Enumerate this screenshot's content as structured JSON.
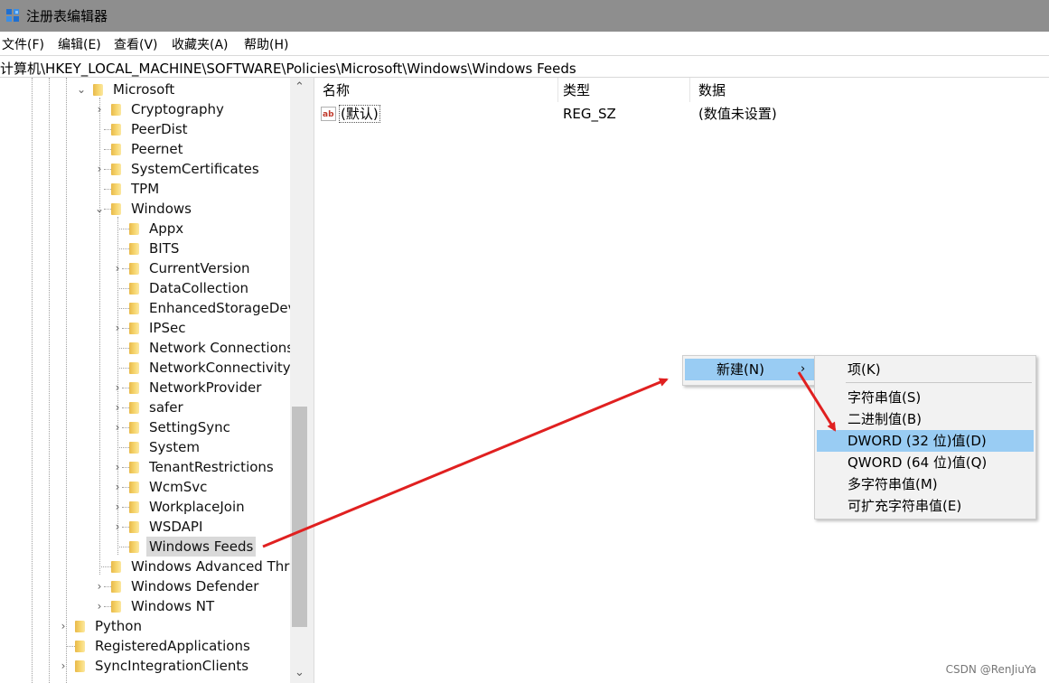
{
  "window": {
    "title": "注册表编辑器"
  },
  "menu": [
    "文件(F)",
    "编辑(E)",
    "查看(V)",
    "收藏夹(A)",
    "帮助(H)"
  ],
  "address": "计算机\\HKEY_LOCAL_MACHINE\\SOFTWARE\\Policies\\Microsoft\\Windows\\Windows Feeds",
  "tree": [
    {
      "label": "Microsoft",
      "expander": "open"
    },
    {
      "label": "Cryptography",
      "expander": "closed"
    },
    {
      "label": "PeerDist",
      "expander": "none"
    },
    {
      "label": "Peernet",
      "expander": "none"
    },
    {
      "label": "SystemCertificates",
      "expander": "closed"
    },
    {
      "label": "TPM",
      "expander": "none"
    },
    {
      "label": "Windows",
      "expander": "open"
    },
    {
      "label": "Appx",
      "expander": "none"
    },
    {
      "label": "BITS",
      "expander": "none"
    },
    {
      "label": "CurrentVersion",
      "expander": "closed"
    },
    {
      "label": "DataCollection",
      "expander": "none"
    },
    {
      "label": "EnhancedStorageDev",
      "expander": "none"
    },
    {
      "label": "IPSec",
      "expander": "closed"
    },
    {
      "label": "Network Connections",
      "expander": "none"
    },
    {
      "label": "NetworkConnectivity:",
      "expander": "none"
    },
    {
      "label": "NetworkProvider",
      "expander": "closed"
    },
    {
      "label": "safer",
      "expander": "closed"
    },
    {
      "label": "SettingSync",
      "expander": "closed"
    },
    {
      "label": "System",
      "expander": "none"
    },
    {
      "label": "TenantRestrictions",
      "expander": "closed"
    },
    {
      "label": "WcmSvc",
      "expander": "closed"
    },
    {
      "label": "WorkplaceJoin",
      "expander": "closed"
    },
    {
      "label": "WSDAPI",
      "expander": "closed"
    },
    {
      "label": "Windows Feeds",
      "expander": "none",
      "selected": true
    },
    {
      "label": "Windows Advanced Thre",
      "expander": "none"
    },
    {
      "label": "Windows Defender",
      "expander": "closed"
    },
    {
      "label": "Windows NT",
      "expander": "closed"
    },
    {
      "label": "Python",
      "expander": "closed"
    },
    {
      "label": "RegisteredApplications",
      "expander": "none"
    },
    {
      "label": "SyncIntegrationClients",
      "expander": "closed"
    }
  ],
  "columns": {
    "name": "名称",
    "type": "类型",
    "data": "数据"
  },
  "values": [
    {
      "name": "(默认)",
      "type": "REG_SZ",
      "data": "(数值未设置)"
    }
  ],
  "context_menu": {
    "new": "新建(N)",
    "submenu": [
      "项(K)",
      "字符串值(S)",
      "二进制值(B)",
      "DWORD (32 位)值(D)",
      "QWORD (64 位)值(Q)",
      "多字符串值(M)",
      "可扩充字符串值(E)"
    ]
  },
  "watermark": "CSDN @RenJiuYa",
  "colors": {
    "highlight": "#99ccf3",
    "arrow": "#e02020",
    "title_bar": "#8e8e8e"
  }
}
